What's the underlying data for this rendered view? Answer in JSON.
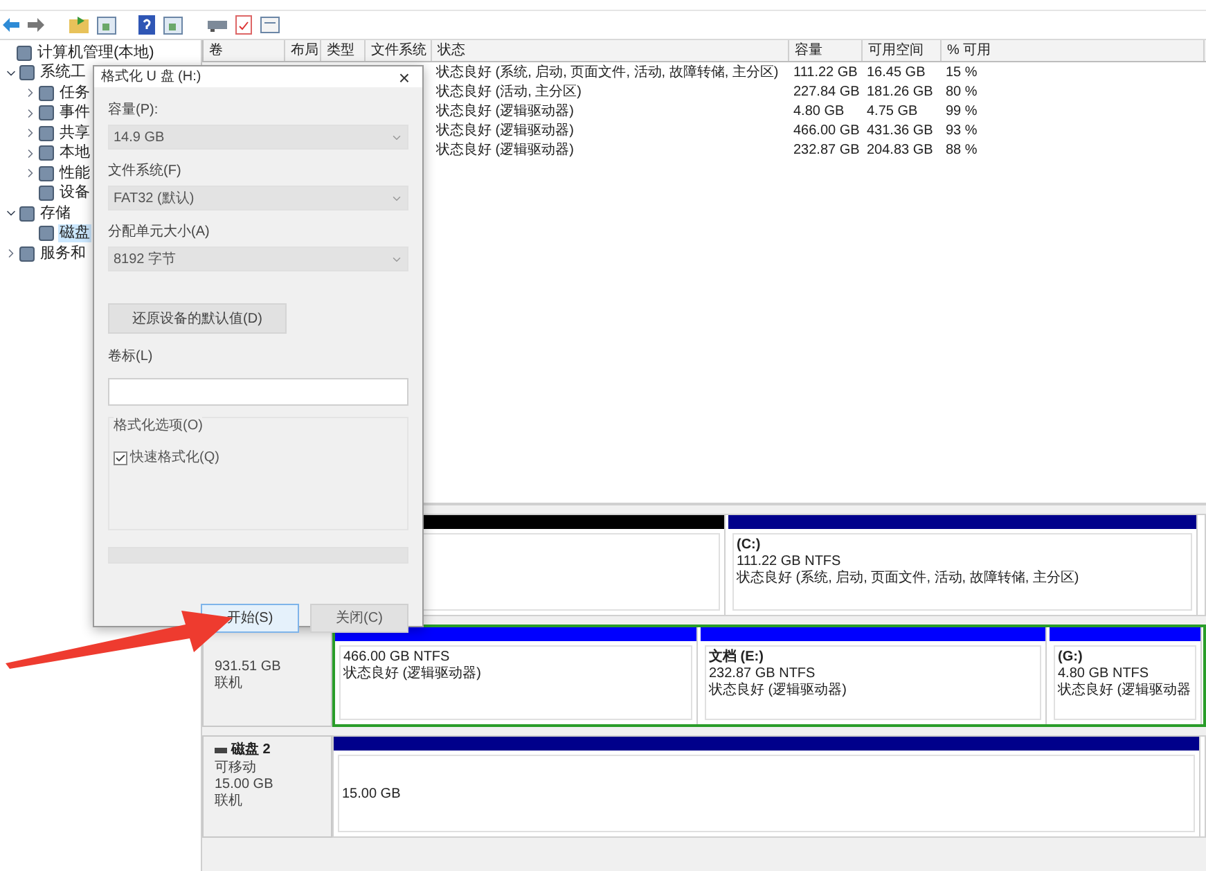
{
  "tree": [
    {
      "label": "计算机管理(本地)",
      "selected": false,
      "children": [
        {
          "label": "系统工",
          "kind": "node",
          "expanded": true,
          "selected": false,
          "children": [
            {
              "label": "任务",
              "kind": "node",
              "expanded": false,
              "selected": false
            },
            {
              "label": "事件",
              "kind": "node",
              "expanded": false,
              "selected": false
            },
            {
              "label": "共享",
              "kind": "node",
              "expanded": false,
              "selected": false
            },
            {
              "label": "本地",
              "kind": "node",
              "expanded": false,
              "selected": false
            },
            {
              "label": "性能",
              "kind": "node",
              "expanded": false,
              "selected": false
            },
            {
              "label": "设备",
              "kind": "leaf",
              "selected": false
            }
          ]
        },
        {
          "label": "存储",
          "kind": "node",
          "expanded": true,
          "selected": false,
          "children": [
            {
              "label": "磁盘",
              "kind": "leaf",
              "selected": true
            }
          ]
        },
        {
          "label": "服务和",
          "kind": "node",
          "expanded": false,
          "selected": false
        }
      ]
    }
  ],
  "volume_table": {
    "columns": [
      "卷",
      "布局",
      "类型",
      "文件系统",
      "状态",
      "容量",
      "可用空间",
      "% 可用"
    ],
    "rows": [
      {
        "status": "状态良好 (系统, 启动, 页面文件, 活动, 故障转储, 主分区)",
        "capacity": "111.22 GB",
        "free": "16.45 GB",
        "percent": "15 %"
      },
      {
        "status": "状态良好 (活动, 主分区)",
        "capacity": "227.84 GB",
        "free": "181.26 GB",
        "percent": "80 %"
      },
      {
        "status": "状态良好 (逻辑驱动器)",
        "capacity": "4.80 GB",
        "free": "4.75 GB",
        "percent": "99 %"
      },
      {
        "status": "状态良好 (逻辑驱动器)",
        "capacity": "466.00 GB",
        "free": "431.36 GB",
        "percent": "93 %"
      },
      {
        "status": "状态良好 (逻辑驱动器)",
        "capacity": "232.87 GB",
        "free": "204.83 GB",
        "percent": "88 %"
      }
    ]
  },
  "disks": [
    {
      "extended": false,
      "partitions": [
        {
          "color": "#000000"
        },
        {
          "color": "#00008b",
          "name": "(C:)",
          "size": "111.22 GB NTFS",
          "status": "状态良好 (系统, 启动, 页面文件, 活动, 故障转储, 主分区)"
        }
      ]
    },
    {
      "info": [
        "931.51 GB",
        "联机"
      ],
      "extended": true,
      "partitions": [
        {
          "color": "#0000ff",
          "size": "466.00 GB NTFS",
          "status": "状态良好 (逻辑驱动器)"
        },
        {
          "color": "#0000ff",
          "name": "文档  (E:)",
          "size": "232.87 GB NTFS",
          "status": "状态良好 (逻辑驱动器)"
        },
        {
          "color": "#0000ff",
          "name": "(G:)",
          "size": "4.80 GB NTFS",
          "status": "状态良好 (逻辑驱动器"
        }
      ]
    },
    {
      "name": "磁盘 2",
      "info": [
        "可移动",
        "15.00 GB",
        "联机"
      ],
      "extended": false,
      "partitions": [
        {
          "color": "#00008b",
          "size": "15.00 GB"
        }
      ]
    }
  ],
  "dialog": {
    "title": "格式化 U 盘 (H:)",
    "close": "×",
    "fields": [
      {
        "label": "容量(P):",
        "value": "14.9 GB",
        "disabled": true
      },
      {
        "label": "文件系统(F)",
        "value": "FAT32 (默认)",
        "disabled": true
      },
      {
        "label": "分配单元大小(A)",
        "value": "8192 字节",
        "disabled": true
      }
    ],
    "restore_button": "还原设备的默认值(D)",
    "volume_label": {
      "label": "卷标(L)"
    },
    "options": {
      "title": "格式化选项(O)",
      "quick_format": {
        "label": "快速格式化(Q)",
        "checked": true
      }
    },
    "progress": {
      "level": 0
    },
    "buttons": [
      {
        "label": "开始(S)",
        "selected": true
      },
      {
        "label": "关闭(C)",
        "selected": false
      }
    ]
  }
}
